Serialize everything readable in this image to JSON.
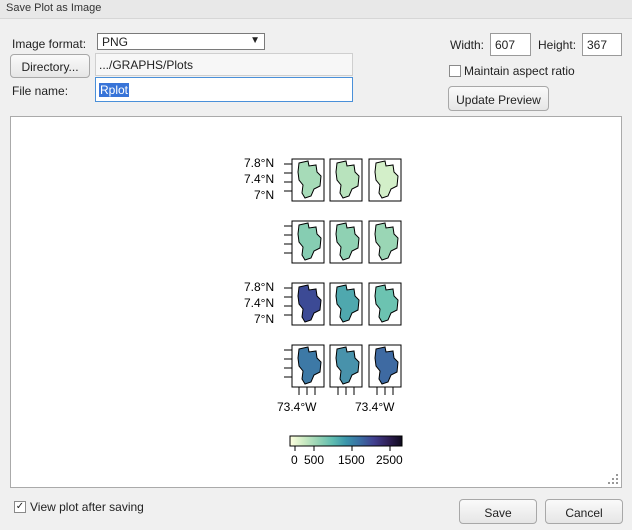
{
  "window": {
    "title": "Save Plot as Image"
  },
  "form": {
    "format_label": "Image format:",
    "format_value": "PNG",
    "directory_button": "Directory...",
    "directory_path": ".../GRAPHS/Plots",
    "filename_label": "File name:",
    "filename_value": "Rplot",
    "width_label": "Width:",
    "width_value": "607",
    "height_label": "Height:",
    "height_value": "367",
    "aspect_label": "Maintain aspect ratio",
    "aspect_checked": false,
    "update_button": "Update Preview"
  },
  "plot": {
    "y_ticks": [
      "7.8°N",
      "7.4°N",
      "7°N"
    ],
    "x_ticks": [
      "73.4°W",
      "73.4°W"
    ],
    "colorbar_ticks": [
      "0",
      "500",
      "1500",
      "2500"
    ],
    "colors": [
      "#ffffe0",
      "#cdebc3",
      "#96d3b4",
      "#5fbcb0",
      "#3b96ab",
      "#3a6fa3",
      "#413f8f",
      "#2f1f55",
      "#0f0a1c"
    ]
  },
  "footer": {
    "view_after_label": "View plot after saving",
    "view_after_checked": true,
    "save_button": "Save",
    "cancel_button": "Cancel"
  }
}
